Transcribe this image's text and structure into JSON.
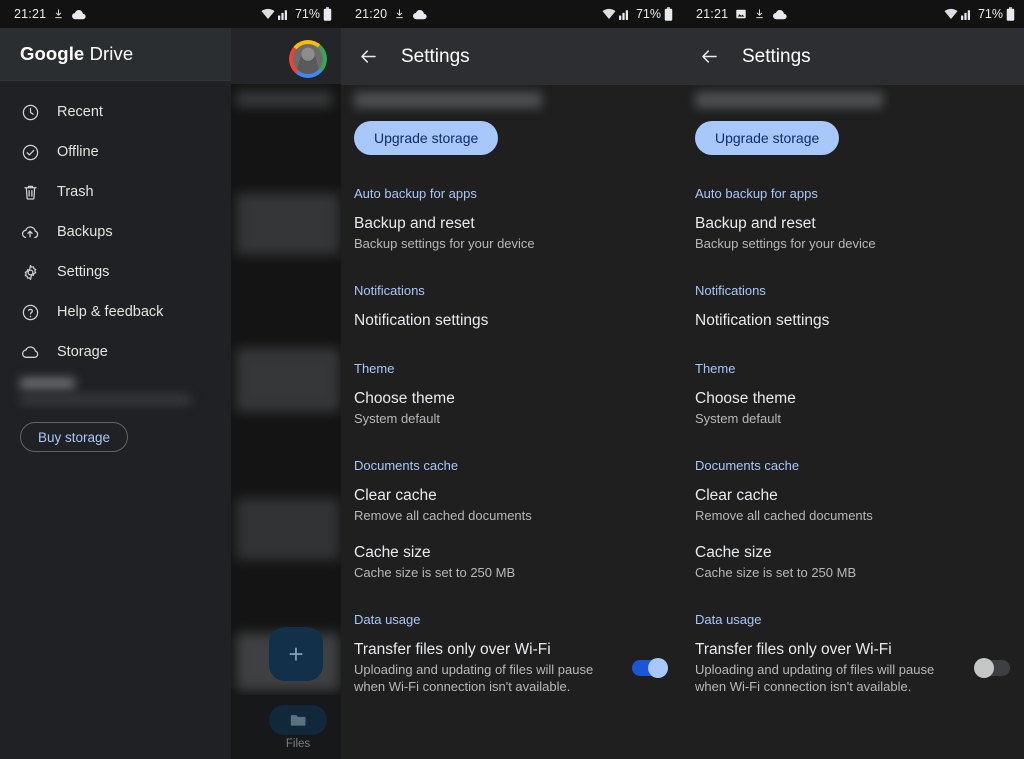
{
  "panels": [
    {
      "id": "drive-nav-drawer",
      "statusbar": {
        "time": "21:21",
        "left_icons": [
          "download-icon",
          "cloud-icon"
        ],
        "battery_text": "71%",
        "right_icons": [
          "wifi-icon",
          "cellular-signal-icon",
          "battery-icon"
        ]
      },
      "drawer": {
        "brand_bold": "Google",
        "brand_light": " Drive",
        "items": [
          {
            "label": "Recent",
            "icon": "clock-icon"
          },
          {
            "label": "Offline",
            "icon": "offline-check-icon"
          },
          {
            "label": "Trash",
            "icon": "trash-icon"
          },
          {
            "label": "Backups",
            "icon": "cloud-upload-icon"
          },
          {
            "label": "Settings",
            "icon": "gear-icon"
          },
          {
            "label": "Help & feedback",
            "icon": "help-circle-icon"
          },
          {
            "label": "Storage",
            "icon": "cloud-icon"
          }
        ],
        "buy_storage_label": "Buy storage"
      },
      "background": {
        "fab_label": "+",
        "bottom_nav_label": "Files"
      }
    },
    {
      "id": "settings-wifi-on",
      "statusbar": {
        "time": "21:20",
        "left_icons": [
          "download-icon",
          "cloud-icon"
        ],
        "battery_text": "71%",
        "right_icons": [
          "wifi-icon",
          "cellular-signal-icon",
          "battery-icon"
        ]
      },
      "appbar": {
        "title": "Settings",
        "back_icon": "back-arrow-icon"
      },
      "upgrade_label": "Upgrade storage",
      "sections": [
        {
          "header": "Auto backup for apps",
          "rows": [
            {
              "title": "Backup and reset",
              "sub": "Backup settings for your device",
              "control": "none"
            }
          ]
        },
        {
          "header": "Notifications",
          "rows": [
            {
              "title": "Notification settings",
              "sub": "",
              "control": "none"
            }
          ]
        },
        {
          "header": "Theme",
          "rows": [
            {
              "title": "Choose theme",
              "sub": "System default",
              "control": "none"
            }
          ]
        },
        {
          "header": "Documents cache",
          "rows": [
            {
              "title": "Clear cache",
              "sub": "Remove all cached documents",
              "control": "none"
            },
            {
              "title": "Cache size",
              "sub": "Cache size is set to 250 MB",
              "control": "none"
            }
          ]
        },
        {
          "header": "Data usage",
          "rows": [
            {
              "title": "Transfer files only over Wi-Fi",
              "sub": "Uploading and updating of files will pause when Wi-Fi connection isn't available.",
              "control": "switch",
              "switch_state": "on"
            }
          ]
        }
      ]
    },
    {
      "id": "settings-wifi-off",
      "statusbar": {
        "time": "21:21",
        "left_icons": [
          "image-icon",
          "download-icon",
          "cloud-icon"
        ],
        "battery_text": "71%",
        "right_icons": [
          "wifi-icon",
          "cellular-signal-icon",
          "battery-icon"
        ]
      },
      "appbar": {
        "title": "Settings",
        "back_icon": "back-arrow-icon"
      },
      "upgrade_label": "Upgrade storage",
      "sections": [
        {
          "header": "Auto backup for apps",
          "rows": [
            {
              "title": "Backup and reset",
              "sub": "Backup settings for your device",
              "control": "none"
            }
          ]
        },
        {
          "header": "Notifications",
          "rows": [
            {
              "title": "Notification settings",
              "sub": "",
              "control": "none"
            }
          ]
        },
        {
          "header": "Theme",
          "rows": [
            {
              "title": "Choose theme",
              "sub": "System default",
              "control": "none"
            }
          ]
        },
        {
          "header": "Documents cache",
          "rows": [
            {
              "title": "Clear cache",
              "sub": "Remove all cached documents",
              "control": "none"
            },
            {
              "title": "Cache size",
              "sub": "Cache size is set to 250 MB",
              "control": "none"
            }
          ]
        },
        {
          "header": "Data usage",
          "rows": [
            {
              "title": "Transfer files only over Wi-Fi",
              "sub": "Uploading and updating of files will pause when Wi-Fi connection isn't available.",
              "control": "switch",
              "switch_state": "off"
            }
          ]
        }
      ]
    }
  ],
  "colors": {
    "accent_blue": "#a8c7fa",
    "switch_on_track": "#1a56d6",
    "switch_on_knob": "#a8c7fa",
    "switch_off_knob": "#c4c7c5",
    "panel_bg": "#1f1f1f",
    "drawer_bg": "#202124",
    "appbar_bg": "#2c2e31",
    "upgrade_btn_bg": "#a8c7fa",
    "upgrade_btn_text": "#0b2f6b"
  }
}
